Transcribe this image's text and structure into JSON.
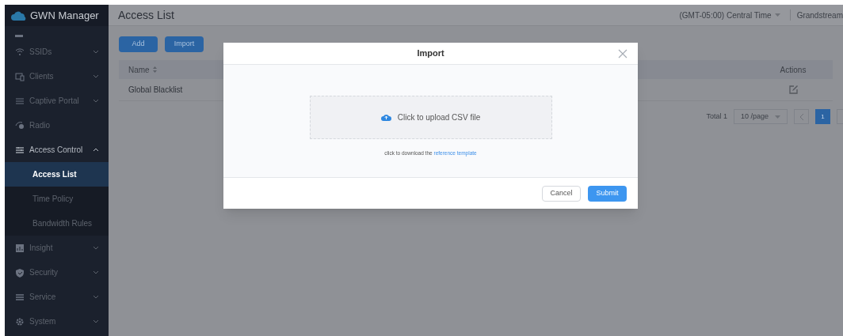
{
  "app": {
    "title": "GWN Manager"
  },
  "sidebar": {
    "items": [
      {
        "label": "SSIDs",
        "kind": "wifi",
        "expanded": false,
        "selected": false
      },
      {
        "label": "Clients",
        "kind": "devices",
        "expanded": false,
        "selected": false
      },
      {
        "label": "Captive Portal",
        "kind": "list",
        "expanded": false,
        "selected": false
      },
      {
        "label": "Radio",
        "kind": "radio",
        "selected": false
      },
      {
        "label": "Access Control",
        "kind": "sliders",
        "expanded": true,
        "selected": false,
        "children": [
          {
            "label": "Access List",
            "selected": true
          },
          {
            "label": "Time Policy",
            "selected": false
          },
          {
            "label": "Bandwidth Rules",
            "selected": false
          }
        ]
      },
      {
        "label": "Insight",
        "kind": "chart",
        "expanded": false,
        "selected": false
      },
      {
        "label": "Security",
        "kind": "shield",
        "expanded": false,
        "selected": false
      },
      {
        "label": "Service",
        "kind": "lines",
        "expanded": false,
        "selected": false
      },
      {
        "label": "System",
        "kind": "gear",
        "expanded": false,
        "selected": false
      }
    ]
  },
  "header": {
    "title": "Access List",
    "timezone": "(GMT-05:00) Central Time",
    "account": "Grandstream"
  },
  "toolbar": {
    "buttons": [
      "Add",
      "Import"
    ]
  },
  "table": {
    "columns": [
      "Name",
      "Actions"
    ],
    "rows": [
      {
        "name": "Global Blacklist"
      }
    ]
  },
  "pagination": {
    "total": "Total 1",
    "page_size": "10 /page",
    "pages": [
      {
        "label": "1",
        "selected": true
      }
    ]
  },
  "dialog": {
    "title": "Import",
    "upload": "Click to upload CSV file",
    "hint": "click to download the",
    "link": "reference template",
    "buttons": [
      {
        "label": "Cancel",
        "kind": "default"
      },
      {
        "label": "Submit",
        "kind": "primary"
      }
    ]
  }
}
